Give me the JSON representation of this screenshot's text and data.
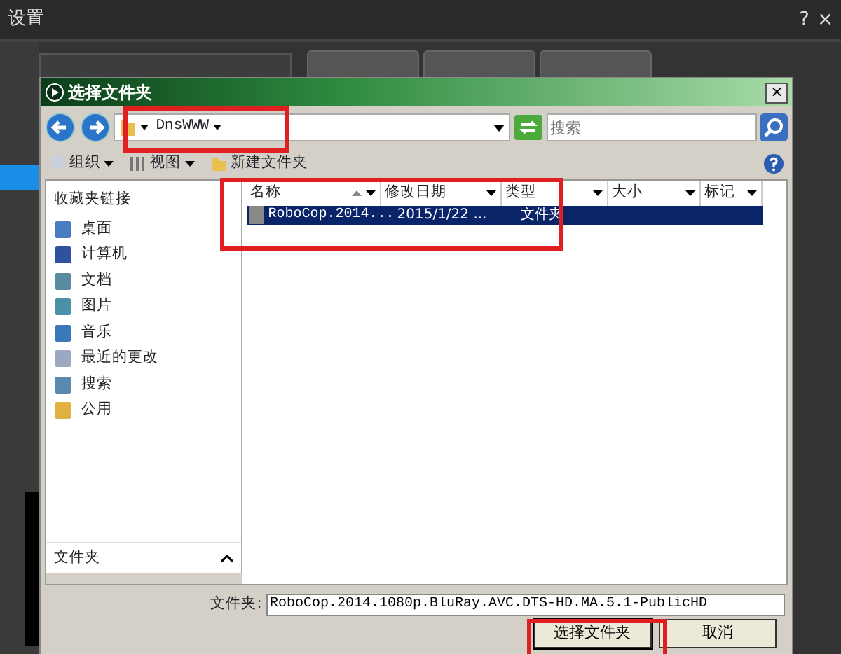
{
  "window": {
    "title": "设置",
    "help": "?",
    "close": "×"
  },
  "dialog": {
    "title": "选择文件夹",
    "close": "×",
    "address": {
      "path": "DnsWWW"
    },
    "search": {
      "placeholder": "搜索"
    },
    "toolbar": [
      {
        "label": "组织",
        "kind": "menu"
      },
      {
        "label": "视图",
        "kind": "menu"
      },
      {
        "label": "新建文件夹",
        "kind": "button"
      }
    ],
    "nav": {
      "heading": "收藏夹链接",
      "items": [
        {
          "label": "桌面"
        },
        {
          "label": "计算机"
        },
        {
          "label": "文档"
        },
        {
          "label": "图片"
        },
        {
          "label": "音乐"
        },
        {
          "label": "最近的更改"
        },
        {
          "label": "搜索"
        },
        {
          "label": "公用"
        }
      ],
      "footer": "文件夹"
    },
    "table": {
      "columns": [
        "名称",
        "修改日期",
        "类型",
        "大小",
        "标记"
      ],
      "rows": [
        {
          "cells": [
            "RoboCop.2014...",
            "2015/1/22 ...",
            "文件夹"
          ],
          "selected": true
        }
      ]
    },
    "folder_field": {
      "label": "文件夹:",
      "value": "RoboCop.2014.1080p.BluRay.AVC.DTS-HD.MA.5.1-PublicHD"
    },
    "buttons": [
      {
        "label": "选择文件夹",
        "kind": "primary"
      },
      {
        "label": "取消",
        "kind": "secondary"
      }
    ]
  }
}
